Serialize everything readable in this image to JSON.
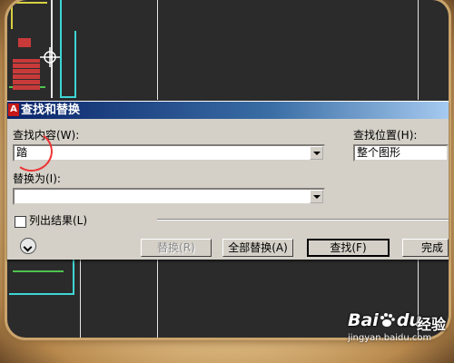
{
  "dialog": {
    "title": "查找和替换",
    "find_label": "查找内容(W):",
    "find_value": "踏",
    "search_location_label": "查找位置(H):",
    "search_location_value": "整个图形",
    "replace_label": "替换为(I):",
    "replace_value": "",
    "list_results_label": "列出结果(L)",
    "list_results_checked": false,
    "buttons": {
      "replace": "替换(R)",
      "replace_all": "全部替换(A)",
      "find": "查找(F)",
      "done": "完成"
    }
  },
  "watermark": {
    "brand": "Bai",
    "brand_tail": "du",
    "name": "经验",
    "url": "jingyan.baidu.com"
  },
  "colors": {
    "canvas": "#2b2b2b",
    "dialog_bg": "#d4d0c8",
    "titlebar_start": "#0a246a",
    "titlebar_end": "#a6caf0",
    "annotation": "#ee3333"
  },
  "icons": {
    "app": "autocad-app-icon",
    "more": "chevron-down-circle-icon",
    "crosshair": "cursor-crosshair-icon",
    "paw": "baidu-paw-icon"
  }
}
